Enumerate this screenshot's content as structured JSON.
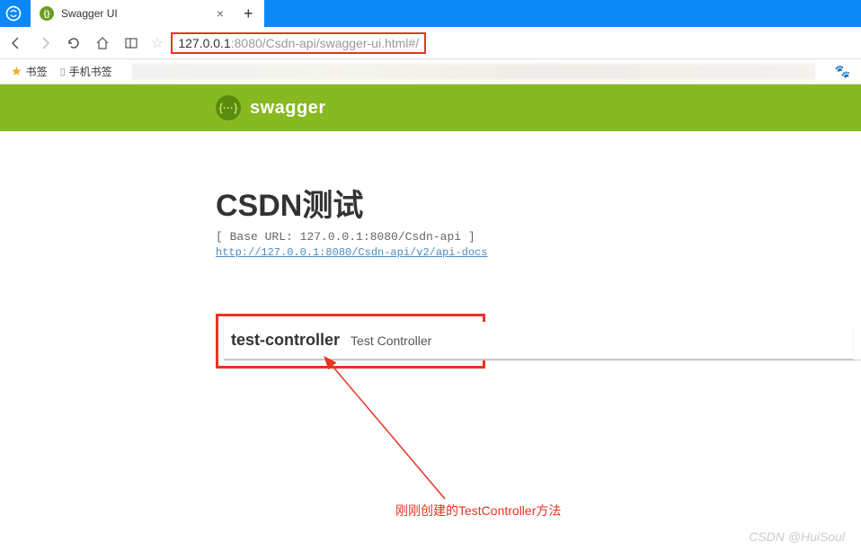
{
  "browser": {
    "tab_title": "Swagger UI",
    "url_host": "127.0.0.1",
    "url_port": ":8080",
    "url_path": "/Csdn-api/swagger-ui.html#/",
    "new_tab": "+"
  },
  "bookmarks": {
    "label": "书签",
    "mobile": "手机书签"
  },
  "swagger": {
    "brand": "swagger",
    "logo_text": "{···}"
  },
  "api": {
    "title": "CSDN测试",
    "base_url": "[ Base URL: 127.0.0.1:8080/Csdn-api ]",
    "docs_link": "http://127.0.0.1:8080/Csdn-api/v2/api-docs"
  },
  "controller": {
    "name": "test-controller",
    "description": "Test Controller"
  },
  "annotation": {
    "text": "刚刚创建的TestController方法"
  },
  "watermark": "CSDN @HuiSoul"
}
